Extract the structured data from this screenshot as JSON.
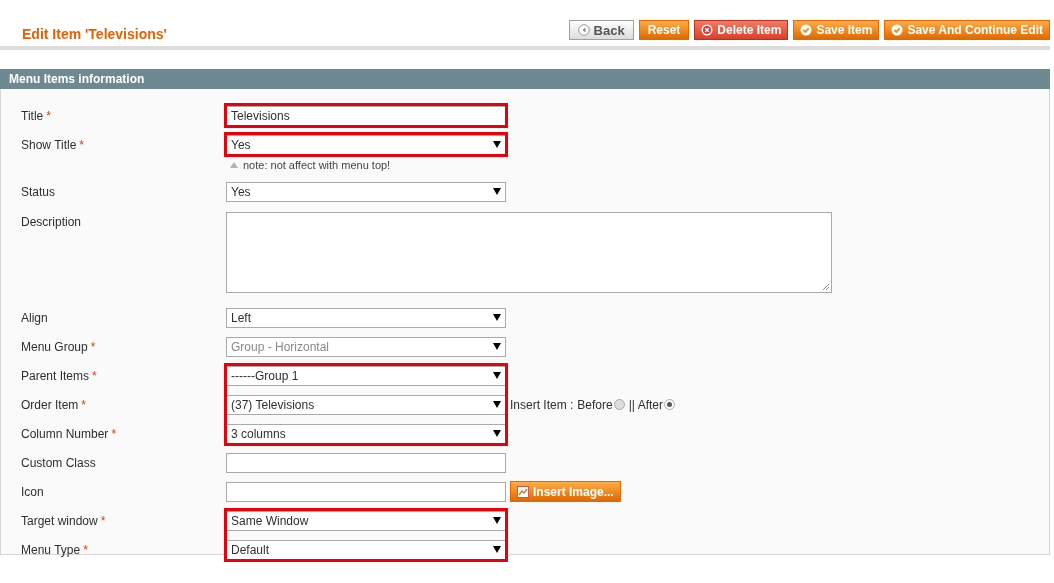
{
  "header": {
    "title": "Edit Item 'Televisions'"
  },
  "buttons": [
    {
      "label": "Back",
      "kind": "back"
    },
    {
      "label": "Reset",
      "kind": "plain"
    },
    {
      "label": "Delete Item",
      "kind": "delete"
    },
    {
      "label": "Save Item",
      "kind": "save"
    },
    {
      "label": "Save And Continue Edit",
      "kind": "save"
    }
  ],
  "section": {
    "title": "Menu Items information"
  },
  "groups": [
    {
      "highlighted": true,
      "fields": [
        {
          "label": "Title",
          "required_mark": "*",
          "kind": "text",
          "value": "Televisions",
          "disabled": false
        }
      ]
    },
    {
      "highlighted": true,
      "fields": [
        {
          "label": "Show Title",
          "required_mark": "*",
          "kind": "select",
          "value": "Yes",
          "disabled": false,
          "note": "note: not affect with menu top!"
        }
      ]
    },
    {
      "highlighted": false,
      "fields": [
        {
          "label": "Status",
          "kind": "select",
          "value": "Yes",
          "disabled": false
        },
        {
          "label": "Description",
          "kind": "textarea",
          "disabled": false
        },
        {
          "label": "Align",
          "kind": "select",
          "value": "Left",
          "disabled": false
        },
        {
          "label": "Menu Group",
          "required_mark": "*",
          "kind": "select",
          "value": "Group - Horizontal",
          "disabled": true
        }
      ]
    },
    {
      "highlighted": true,
      "fields": [
        {
          "label": "Parent Items",
          "required_mark": "*",
          "kind": "select",
          "value": "------Group 1",
          "disabled": false
        },
        {
          "label": "Order Item",
          "required_mark": "*",
          "kind": "select",
          "value": "(37) Televisions",
          "disabled": false,
          "insert": {
            "label": "Insert Item :",
            "options": [
              {
                "label": "Before",
                "selected": false
              },
              {
                "label": "|| After",
                "selected": true
              }
            ]
          }
        },
        {
          "label": "Column Number",
          "required_mark": "*",
          "kind": "select",
          "value": "3 columns",
          "disabled": false
        }
      ]
    },
    {
      "highlighted": false,
      "fields": [
        {
          "label": "Custom Class",
          "kind": "text",
          "disabled": false
        },
        {
          "label": "Icon",
          "kind": "text",
          "disabled": false,
          "button": {
            "label": "Insert Image..."
          }
        }
      ]
    },
    {
      "highlighted": true,
      "fields": [
        {
          "label": "Target window",
          "required_mark": "*",
          "kind": "select",
          "value": "Same Window",
          "disabled": false
        },
        {
          "label": "Menu Type",
          "required_mark": "*",
          "kind": "select",
          "value": "Default",
          "disabled": false
        }
      ]
    }
  ]
}
